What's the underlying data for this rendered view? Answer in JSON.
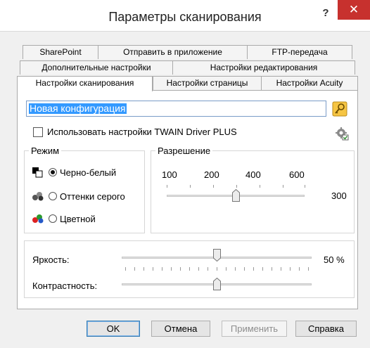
{
  "window": {
    "title": "Параметры сканирования",
    "help_label": "?",
    "close_label": "✕"
  },
  "tabs": {
    "row1": [
      "SharePoint",
      "Отправить в приложение",
      "FTP-передача"
    ],
    "row2": [
      "Дополнительные настройки",
      "Настройки редактирования"
    ],
    "row3": [
      "Настройки сканирования",
      "Настройки страницы",
      "Настройки Acuity"
    ],
    "active": "Настройки сканирования"
  },
  "config": {
    "name": "Новая конфигурация",
    "key_icon": "key-icon"
  },
  "twain": {
    "label": "Использовать настройки TWAIN Driver PLUS",
    "checked": false,
    "icon": "scanner-gear-icon"
  },
  "mode": {
    "label": "Режим",
    "options": [
      {
        "label": "Черно-белый",
        "checked": true,
        "icon": "black-white-icon"
      },
      {
        "label": "Оттенки серого",
        "checked": false,
        "icon": "grayscale-icon"
      },
      {
        "label": "Цветной",
        "checked": false,
        "icon": "color-icon"
      }
    ]
  },
  "resolution": {
    "label": "Разрешение",
    "ticks": [
      "100",
      "200",
      "400",
      "600"
    ],
    "value": "300",
    "value_num": 300,
    "min": 100,
    "max": 600
  },
  "brightness": {
    "label": "Яркость:",
    "value": "50 %",
    "percent": 50
  },
  "contrast": {
    "label": "Контрастность:",
    "percent": 50
  },
  "buttons": {
    "ok": "OK",
    "cancel": "Отмена",
    "apply": "Применить",
    "help": "Справка"
  }
}
